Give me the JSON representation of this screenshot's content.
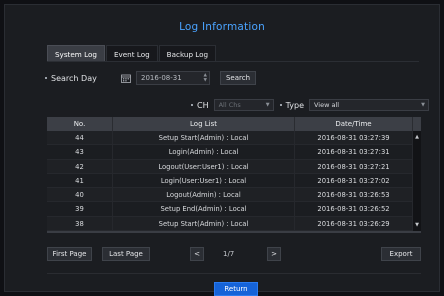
{
  "window": {
    "title": "Log Information"
  },
  "tabs": [
    {
      "label": "System Log",
      "active": true
    },
    {
      "label": "Event Log",
      "active": false
    },
    {
      "label": "Backup Log",
      "active": false
    }
  ],
  "search": {
    "label": "Search Day",
    "date": "2016-08-31",
    "button": "Search"
  },
  "filters": {
    "ch_label": "CH",
    "ch_value": "All Chs",
    "type_label": "Type",
    "type_value": "View all"
  },
  "table": {
    "headers": [
      "No.",
      "Log List",
      "Date/Time"
    ],
    "rows": [
      {
        "no": "44",
        "log": "Setup Start(Admin) : Local",
        "datetime": "2016-08-31 03:27:39"
      },
      {
        "no": "43",
        "log": "Login(Admin) : Local",
        "datetime": "2016-08-31 03:27:31"
      },
      {
        "no": "42",
        "log": "Logout(User:User1) : Local",
        "datetime": "2016-08-31 03:27:21"
      },
      {
        "no": "41",
        "log": "Login(User:User1) : Local",
        "datetime": "2016-08-31 03:27:02"
      },
      {
        "no": "40",
        "log": "Logout(Admin) : Local",
        "datetime": "2016-08-31 03:26:53"
      },
      {
        "no": "39",
        "log": "Setup End(Admin) : Local",
        "datetime": "2016-08-31 03:26:52"
      },
      {
        "no": "38",
        "log": "Setup Start(Admin) : Local",
        "datetime": "2016-08-31 03:26:29"
      }
    ]
  },
  "pager": {
    "first": "First Page",
    "last": "Last Page",
    "prev_icon": "<",
    "next_icon": ">",
    "page": "1/7",
    "export": "Export"
  },
  "footer": {
    "return": "Return"
  },
  "colors": {
    "accent": "#4aa3ff",
    "primary_button": "#1563d8",
    "background": "#1b1d21",
    "header_row": "#3c3f46"
  },
  "icons": {
    "calendar": "calendar-icon",
    "scroll_up": "scroll-up-icon",
    "scroll_down": "scroll-down-icon"
  }
}
